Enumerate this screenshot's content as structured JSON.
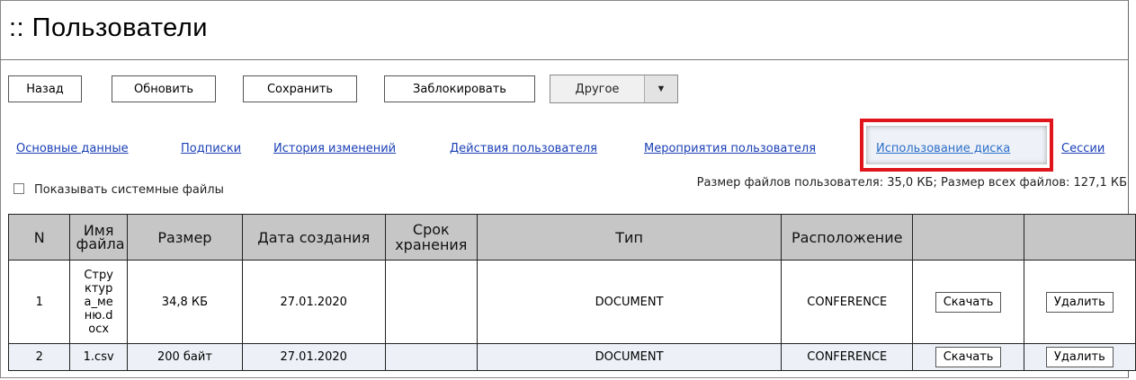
{
  "page": {
    "title": ":: Пользователи"
  },
  "toolbar": {
    "back": "Назад",
    "refresh": "Обновить",
    "save": "Сохранить",
    "block": "Заблокировать",
    "other": "Другое",
    "other_arrow": "▼"
  },
  "tabs": [
    {
      "label": "Основные данные"
    },
    {
      "label": "Подписки"
    },
    {
      "label": "История изменений"
    },
    {
      "label": "Действия пользователя"
    },
    {
      "label": "Мероприятия пользователя"
    },
    {
      "label": "Использование диска",
      "active": true
    },
    {
      "label": "Сессии"
    }
  ],
  "options": {
    "show_system_files": "Показывать системные файлы"
  },
  "sizes_text": "Размер файлов пользователя: 35,0 КБ; Размер всех файлов: 127,1 КБ",
  "table": {
    "headers": [
      "N",
      "Имя файла",
      "Размер",
      "Дата создания",
      "Срок хранения",
      "Тип",
      "Расположение",
      "",
      ""
    ],
    "rows": [
      {
        "n": "1",
        "name": "Структура_меню.docx",
        "size": "34,8 КБ",
        "created": "27.01.2020",
        "retention": "",
        "type": "DOCUMENT",
        "location": "CONFERENCE",
        "download": "Скачать",
        "delete": "Удалить"
      },
      {
        "n": "2",
        "name": "1.csv",
        "size": "200 байт",
        "created": "27.01.2020",
        "retention": "",
        "type": "DOCUMENT",
        "location": "CONFERENCE",
        "download": "Скачать",
        "delete": "Удалить"
      }
    ]
  },
  "colors": {
    "link": "#1a3fb5",
    "highlight_border": "#e0141b",
    "header_bg": "#c6c6c6",
    "alt_row_bg": "#edf1f7"
  }
}
